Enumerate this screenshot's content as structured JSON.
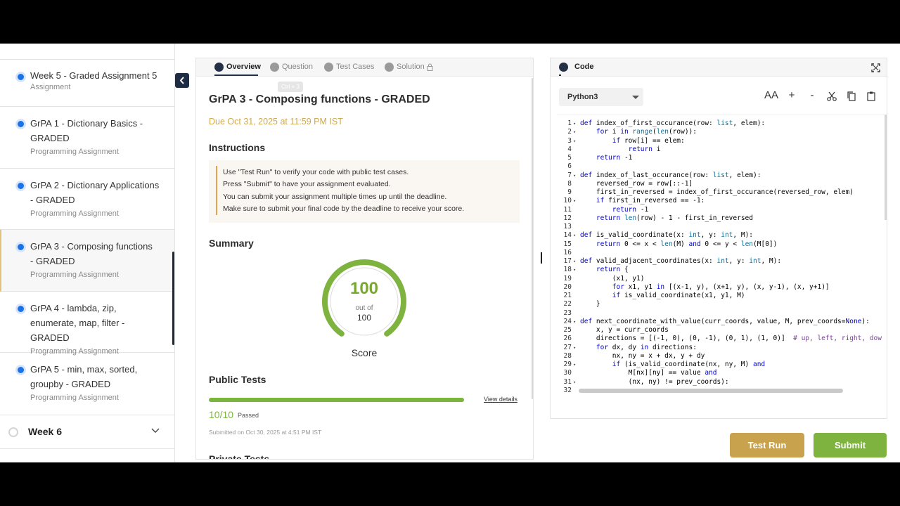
{
  "sidebar": {
    "items": [
      {
        "title": "Week 5 - Graded Assignment 5",
        "sub": "Assignment"
      },
      {
        "title": "GrPA 1 - Dictionary Basics - GRADED",
        "sub": "Programming Assignment"
      },
      {
        "title": "GrPA 2 - Dictionary Applications - GRADED",
        "sub": "Programming Assignment"
      },
      {
        "title": "GrPA 3 - Composing functions - GRADED",
        "sub": "Programming Assignment"
      },
      {
        "title": "GrPA 4 - lambda, zip, enumerate, map, filter - GRADED",
        "sub": "Programming Assignment"
      },
      {
        "title": "GrPA 5 - min, max, sorted, groupby - GRADED",
        "sub": "Programming Assignment"
      }
    ],
    "week": {
      "label": "Week 6"
    }
  },
  "tabs": [
    {
      "label": "Overview"
    },
    {
      "label": "Question"
    },
    {
      "label": "Test Cases"
    },
    {
      "label": "Solution"
    }
  ],
  "tooltip": "Ctrl + 3",
  "overview": {
    "title": "GrPA 3 - Composing functions - GRADED",
    "due": "Due Oct 31, 2025 at 11:59 PM IST",
    "instructions_heading": "Instructions",
    "instructions": [
      "Use \"Test Run\" to verify your code with public test cases.",
      "Press \"Submit\" to have your assignment evaluated.",
      "You can submit your assignment multiple times up until the deadline.",
      "Make sure to submit your final code by the deadline to receive your score."
    ],
    "summary_heading": "Summary",
    "score": {
      "value": "100",
      "out_of": "out of",
      "max": "100",
      "label": "Score",
      "fraction": 1.0
    },
    "public_tests_heading": "Public Tests",
    "public_tests": {
      "count": "10/10",
      "passed": "Passed",
      "progress": 1.0,
      "view_details": "View details",
      "submitted": "Submitted on Oct 30, 2025 at 4:51 PM IST"
    },
    "private_tests_heading": "Private Tests"
  },
  "code": {
    "tab_label": "Code",
    "language": "Python3",
    "font_size_icon": "AA",
    "zoom_in": "+",
    "zoom_out": "-",
    "lines": [
      {
        "n": "1",
        "fold": true,
        "t": "def index_of_first_occurance(row: list, elem):"
      },
      {
        "n": "2",
        "fold": true,
        "t": "    for i in range(len(row)):"
      },
      {
        "n": "3",
        "fold": true,
        "t": "        if row[i] == elem:"
      },
      {
        "n": "4",
        "fold": false,
        "t": "            return i"
      },
      {
        "n": "5",
        "fold": false,
        "t": "    return -1"
      },
      {
        "n": "6",
        "fold": false,
        "t": ""
      },
      {
        "n": "7",
        "fold": true,
        "t": "def index_of_last_occurance(row: list, elem):"
      },
      {
        "n": "8",
        "fold": false,
        "t": "    reversed_row = row[::-1]"
      },
      {
        "n": "9",
        "fold": false,
        "t": "    first_in_reversed = index_of_first_occurance(reversed_row, elem)"
      },
      {
        "n": "10",
        "fold": true,
        "t": "    if first_in_reversed == -1:"
      },
      {
        "n": "11",
        "fold": false,
        "t": "        return -1"
      },
      {
        "n": "12",
        "fold": false,
        "t": "    return len(row) - 1 - first_in_reversed"
      },
      {
        "n": "13",
        "fold": false,
        "t": ""
      },
      {
        "n": "14",
        "fold": true,
        "t": "def is_valid_coordinate(x: int, y: int, M):"
      },
      {
        "n": "15",
        "fold": false,
        "t": "    return 0 <= x < len(M) and 0 <= y < len(M[0])"
      },
      {
        "n": "16",
        "fold": false,
        "t": ""
      },
      {
        "n": "17",
        "fold": true,
        "t": "def valid_adjacent_coordinates(x: int, y: int, M):"
      },
      {
        "n": "18",
        "fold": true,
        "t": "    return {"
      },
      {
        "n": "19",
        "fold": false,
        "t": "        (x1, y1)"
      },
      {
        "n": "20",
        "fold": false,
        "t": "        for x1, y1 in [(x-1, y), (x+1, y), (x, y-1), (x, y+1)]"
      },
      {
        "n": "21",
        "fold": false,
        "t": "        if is_valid_coordinate(x1, y1, M)"
      },
      {
        "n": "22",
        "fold": false,
        "t": "    }"
      },
      {
        "n": "23",
        "fold": false,
        "t": ""
      },
      {
        "n": "24",
        "fold": true,
        "t": "def next_coordinate_with_value(curr_coords, value, M, prev_coords=None):"
      },
      {
        "n": "25",
        "fold": false,
        "t": "    x, y = curr_coords"
      },
      {
        "n": "26",
        "fold": false,
        "t": "    directions = [(-1, 0), (0, -1), (0, 1), (1, 0)]  # up, left, right, dow"
      },
      {
        "n": "27",
        "fold": true,
        "t": "    for dx, dy in directions:"
      },
      {
        "n": "28",
        "fold": false,
        "t": "        nx, ny = x + dx, y + dy"
      },
      {
        "n": "29",
        "fold": true,
        "t": "        if (is_valid_coordinate(nx, ny, M) and"
      },
      {
        "n": "30",
        "fold": false,
        "t": "            M[nx][ny] == value and"
      },
      {
        "n": "31",
        "fold": true,
        "t": "            (nx, ny) != prev_coords):"
      },
      {
        "n": "32",
        "fold": false,
        "t": ""
      }
    ]
  },
  "actions": {
    "test_run": "Test Run",
    "submit": "Submit"
  },
  "colors": {
    "accent_gold": "#c9a24e",
    "success_green": "#7eb33f",
    "nav_dark": "#1f2d44",
    "active_dot": "#1a73e8"
  }
}
